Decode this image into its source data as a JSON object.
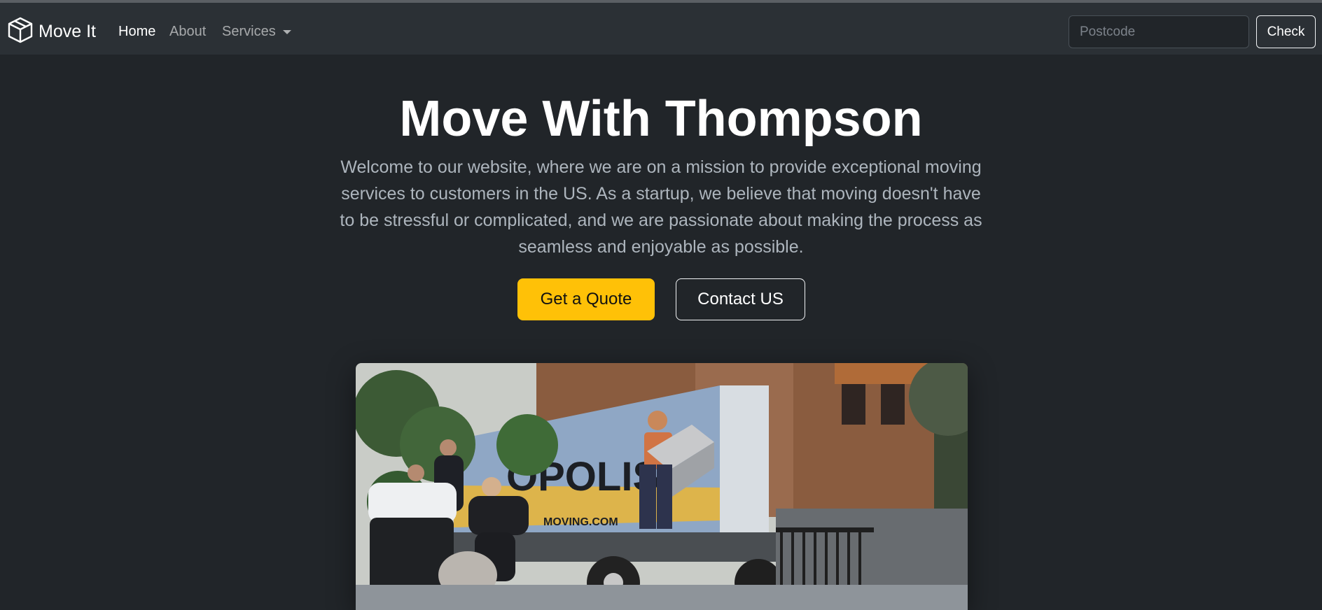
{
  "brand": {
    "name": "Move It",
    "icon": "box-icon"
  },
  "nav": {
    "home": "Home",
    "about": "About",
    "services": "Services"
  },
  "search": {
    "placeholder": "Postcode",
    "value": "",
    "button": "Check"
  },
  "hero": {
    "title": "Move With Thompson",
    "lead": "Welcome to our website, where we are on a mission to provide exceptional moving services to customers in the US. As a startup, we believe that moving doesn't have to be stressful or complicated, and we are passionate about making the process as seamless and enjoyable as possible.",
    "primary_button": "Get a Quote",
    "secondary_button": "Contact US",
    "image_truck_text": "OPOLIS",
    "image_truck_url_text": "MOVING.COM"
  },
  "colors": {
    "background": "#212529",
    "navbar": "#2b3035",
    "accent": "#ffc107"
  }
}
